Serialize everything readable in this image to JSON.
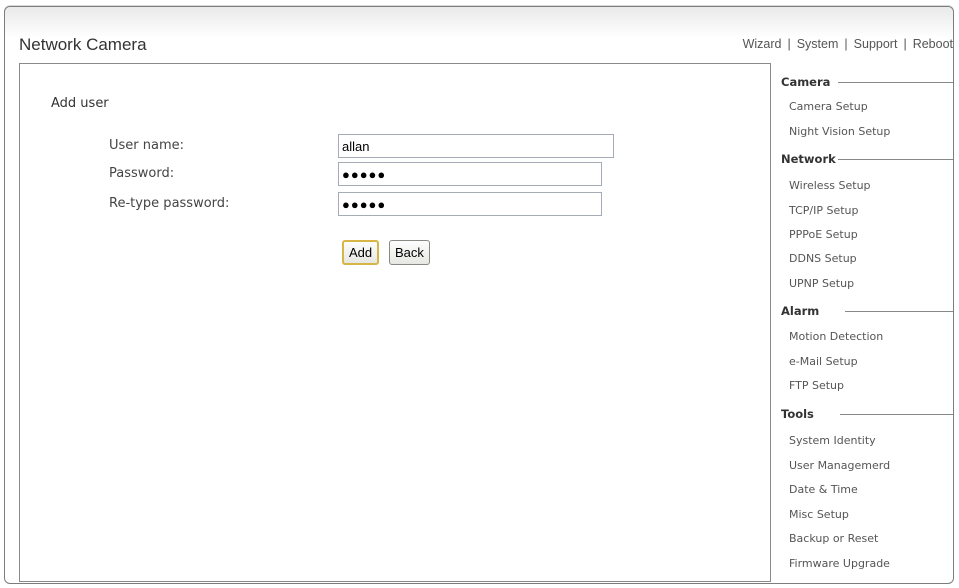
{
  "app": {
    "title": "Network Camera"
  },
  "topnav": {
    "items": [
      "Wizard",
      "System",
      "Support",
      "Reboot"
    ],
    "separator": "|"
  },
  "form": {
    "heading": "Add user",
    "fields": [
      {
        "label": "User name:",
        "value": "allan",
        "type": "text"
      },
      {
        "label": "Password:",
        "value": "●●●●●",
        "type": "password"
      },
      {
        "label": "Re-type password:",
        "value": "●●●●●",
        "type": "password"
      }
    ],
    "add_label": "Add",
    "back_label": "Back"
  },
  "sidebar": {
    "sections": [
      {
        "title": "Camera",
        "items": [
          "Camera Setup",
          "Night Vision Setup"
        ]
      },
      {
        "title": "Network",
        "items": [
          "Wireless Setup",
          "TCP/IP Setup",
          "PPPoE Setup",
          "DDNS Setup",
          "UPNP Setup"
        ]
      },
      {
        "title": "Alarm",
        "items": [
          "Motion Detection",
          "e-Mail Setup",
          "FTP Setup"
        ]
      },
      {
        "title": "Tools",
        "items": [
          "System Identity",
          "User Managemerd",
          "Date & Time",
          "Misc Setup",
          "Backup or Reset",
          "Firmware Upgrade"
        ]
      }
    ]
  },
  "colors": {
    "primary_button_border": "#d7b547",
    "panel_border": "#8a8a8a"
  }
}
